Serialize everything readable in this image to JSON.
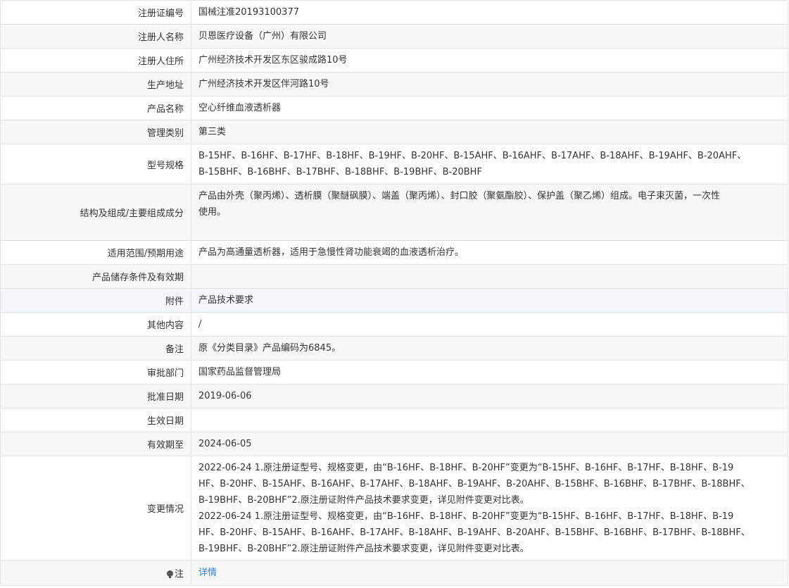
{
  "rows": [
    {
      "label": "注册证编号",
      "value": "国械注准20193100377"
    },
    {
      "label": "注册人名称",
      "value": "贝恩医疗设备（广州）有限公司"
    },
    {
      "label": "注册人住所",
      "value": "广州经济技术开发区东区骏成路10号"
    },
    {
      "label": "生产地址",
      "value": "广州经济技术开发区伴河路10号"
    },
    {
      "label": "产品名称",
      "value": "空心纤维血液透析器"
    },
    {
      "label": "管理类别",
      "value": "第三类"
    },
    {
      "label": "型号规格",
      "value": "B-15HF、B-16HF、B-17HF、B-18HF、B-19HF、B-20HF、B-15AHF、B-16AHF、B-17AHF、B-18AHF、B-19AHF、B-20AHF、\nB-15BHF、B-16BHF、B-17BHF、B-18BHF、B-19BHF、B-20BHF"
    },
    {
      "label": "结构及组成/主要组成成分",
      "value": "产品由外壳（聚丙烯）、透析膜（聚醚砜膜）、端盖（聚丙烯）、封口胶（聚氨酯胶）、保护盖（聚乙烯）组成。电子束灭菌，一次性\n使用。"
    },
    {
      "label": "适用范围/预期用途",
      "value": "产品为高通量透析器，适用于急慢性肾功能衰竭的血液透析治疗。"
    },
    {
      "label": "产品储存条件及有效期",
      "value": ""
    },
    {
      "label": "附件",
      "value": "产品技术要求"
    },
    {
      "label": "其他内容",
      "value": "/"
    },
    {
      "label": "备注",
      "value": "原《分类目录》产品编码为6845。"
    },
    {
      "label": "审批部门",
      "value": "国家药品监督管理局"
    },
    {
      "label": "批准日期",
      "value": "2019-06-06"
    },
    {
      "label": "生效日期",
      "value": ""
    },
    {
      "label": "有效期至",
      "value": "2024-06-05"
    },
    {
      "label": "变更情况",
      "value": "2022-06-24 1.原注册证型号、规格变更，由“B-16HF、B-18HF、B-20HF”变更为“B-15HF、B-16HF、B-17HF、B-18HF、B-19\nHF、B-20HF、B-15AHF、B-16AHF、B-17AHF、B-18AHF、B-19AHF、B-20AHF、B-15BHF、B-16BHF、B-17BHF、B-18BHF、\nB-19BHF、B-20BHF”2.原注册证附件产品技术要求变更，详见附件变更对比表。\n2022-06-24 1.原注册证型号、规格变更，由“B-16HF、B-18HF、B-20HF”变更为“B-15HF、B-16HF、B-17HF、B-18HF、B-19\nHF、B-20HF、B-15AHF、B-16AHF、B-17AHF、B-18AHF、B-19AHF、B-20AHF、B-15BHF、B-16BHF、B-17BHF、B-18BHF、\nB-19BHF、B-20BHF”2.原注册证附件产品技术要求变更，详见附件变更对比表。"
    }
  ],
  "note": {
    "label": "注",
    "link_text": "详情",
    "icon": "lightbulb-icon"
  }
}
